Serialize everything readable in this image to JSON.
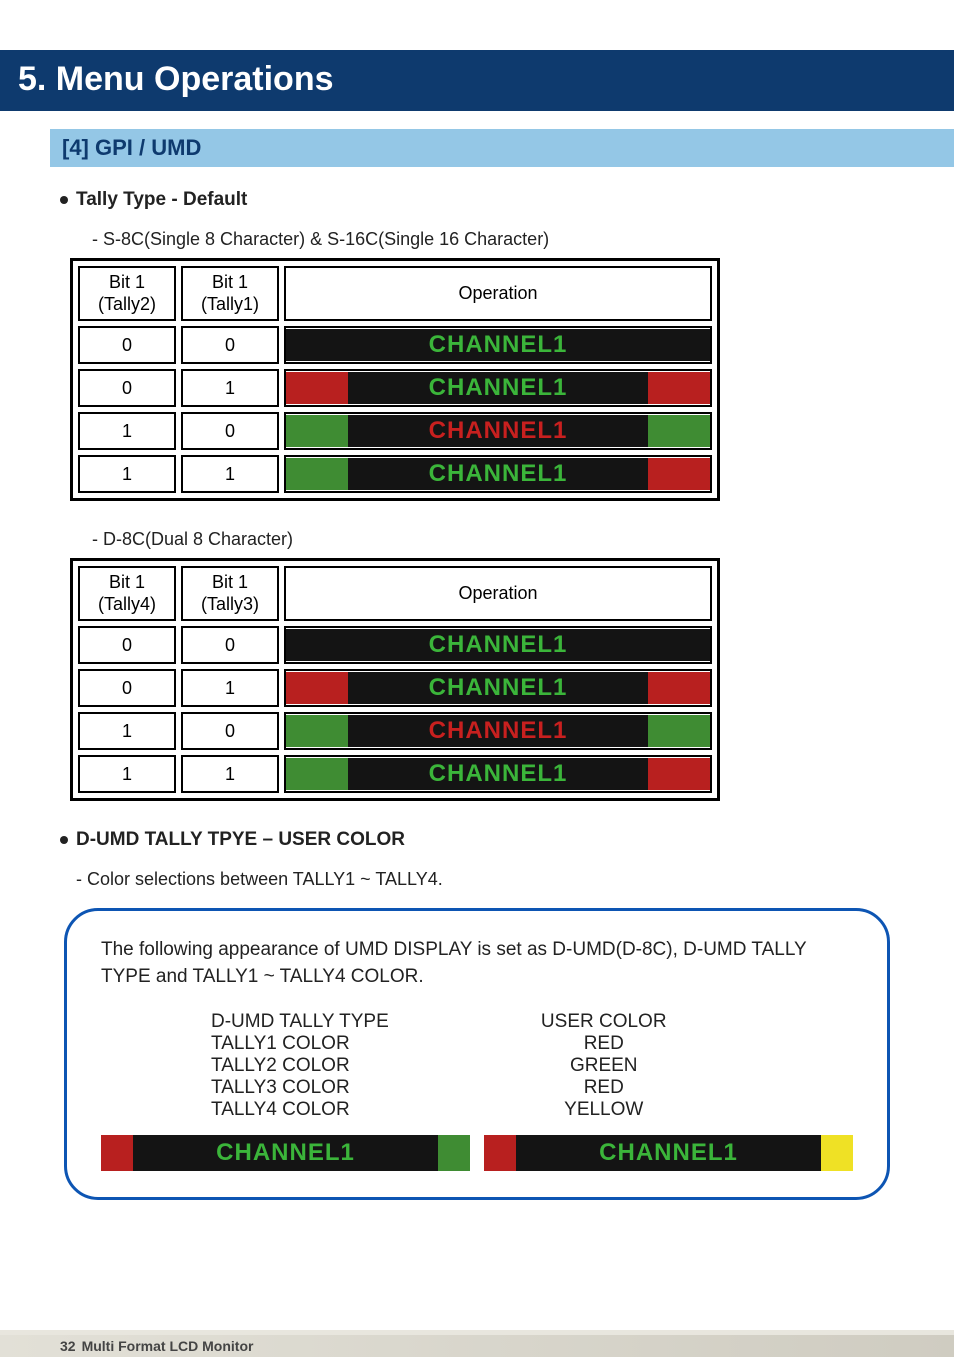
{
  "chapter": "5. Menu Operations",
  "section": "[4] GPI / UMD",
  "bullet1": "Tally Type - Default",
  "sub1": "- S-8C(Single 8 Character)  & S-16C(Single 16 Character)",
  "sub2": "- D-8C(Dual 8 Character)",
  "bullet2": "D-UMD TALLY TPYE – USER COLOR",
  "sub3": "- Color selections between TALLY1 ~ TALLY4.",
  "table1": {
    "h1a": "Bit 1",
    "h1b": "(Tally2)",
    "h2a": "Bit 1",
    "h2b": "(Tally1)",
    "h3": "Operation",
    "rows": [
      {
        "b1": "0",
        "b2": "0",
        "left": "black",
        "right": "black",
        "fg": "green",
        "label": "CHANNEL1"
      },
      {
        "b1": "0",
        "b2": "1",
        "left": "red",
        "right": "red",
        "fg": "green",
        "label": "CHANNEL1"
      },
      {
        "b1": "1",
        "b2": "0",
        "left": "green",
        "right": "green",
        "fg": "red",
        "label": "CHANNEL1"
      },
      {
        "b1": "1",
        "b2": "1",
        "left": "green",
        "right": "red",
        "fg": "green",
        "label": "CHANNEL1"
      }
    ]
  },
  "table2": {
    "h1a": "Bit 1",
    "h1b": "(Tally4)",
    "h2a": "Bit 1",
    "h2b": "(Tally3)",
    "h3": "Operation",
    "rows": [
      {
        "b1": "0",
        "b2": "0",
        "left": "black",
        "right": "black",
        "fg": "green",
        "label": "CHANNEL1"
      },
      {
        "b1": "0",
        "b2": "1",
        "left": "red",
        "right": "red",
        "fg": "green",
        "label": "CHANNEL1"
      },
      {
        "b1": "1",
        "b2": "0",
        "left": "green",
        "right": "green",
        "fg": "red",
        "label": "CHANNEL1"
      },
      {
        "b1": "1",
        "b2": "1",
        "left": "green",
        "right": "red",
        "fg": "green",
        "label": "CHANNEL1"
      }
    ]
  },
  "info": {
    "text": "The following appearance of UMD DISPLAY is set as D-UMD(D-8C), D-UMD TALLY TYPE and TALLY1 ~ TALLY4 COLOR.",
    "left": [
      "D-UMD TALLY TYPE",
      "TALLY1 COLOR",
      "TALLY2 COLOR",
      "TALLY3 COLOR",
      "TALLY4 COLOR"
    ],
    "right": [
      "USER COLOR",
      "RED",
      "GREEN",
      "RED",
      "YELLOW"
    ],
    "strip1": {
      "left": "red",
      "right": "green",
      "label": "CHANNEL1"
    },
    "strip2": {
      "left": "red",
      "right": "yellow",
      "label": "CHANNEL1"
    }
  },
  "footer": {
    "page": "32",
    "title": "Multi Format LCD Monitor"
  }
}
